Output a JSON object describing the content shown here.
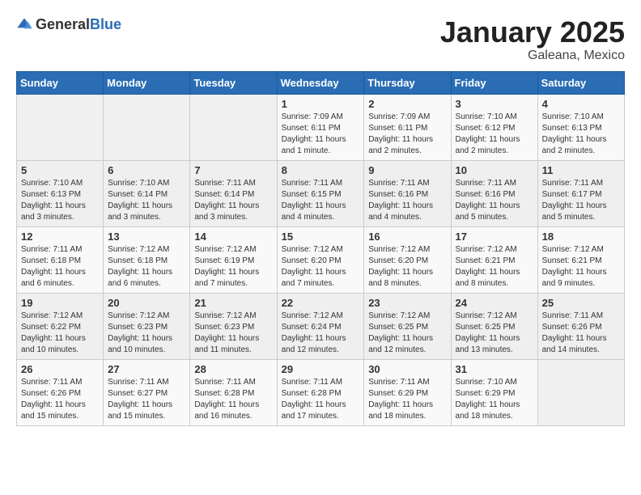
{
  "header": {
    "logo_general": "General",
    "logo_blue": "Blue",
    "month": "January 2025",
    "location": "Galeana, Mexico"
  },
  "weekdays": [
    "Sunday",
    "Monday",
    "Tuesday",
    "Wednesday",
    "Thursday",
    "Friday",
    "Saturday"
  ],
  "weeks": [
    [
      {
        "day": "",
        "info": ""
      },
      {
        "day": "",
        "info": ""
      },
      {
        "day": "",
        "info": ""
      },
      {
        "day": "1",
        "info": "Sunrise: 7:09 AM\nSunset: 6:11 PM\nDaylight: 11 hours and 1 minute."
      },
      {
        "day": "2",
        "info": "Sunrise: 7:09 AM\nSunset: 6:11 PM\nDaylight: 11 hours and 2 minutes."
      },
      {
        "day": "3",
        "info": "Sunrise: 7:10 AM\nSunset: 6:12 PM\nDaylight: 11 hours and 2 minutes."
      },
      {
        "day": "4",
        "info": "Sunrise: 7:10 AM\nSunset: 6:13 PM\nDaylight: 11 hours and 2 minutes."
      }
    ],
    [
      {
        "day": "5",
        "info": "Sunrise: 7:10 AM\nSunset: 6:13 PM\nDaylight: 11 hours and 3 minutes."
      },
      {
        "day": "6",
        "info": "Sunrise: 7:10 AM\nSunset: 6:14 PM\nDaylight: 11 hours and 3 minutes."
      },
      {
        "day": "7",
        "info": "Sunrise: 7:11 AM\nSunset: 6:14 PM\nDaylight: 11 hours and 3 minutes."
      },
      {
        "day": "8",
        "info": "Sunrise: 7:11 AM\nSunset: 6:15 PM\nDaylight: 11 hours and 4 minutes."
      },
      {
        "day": "9",
        "info": "Sunrise: 7:11 AM\nSunset: 6:16 PM\nDaylight: 11 hours and 4 minutes."
      },
      {
        "day": "10",
        "info": "Sunrise: 7:11 AM\nSunset: 6:16 PM\nDaylight: 11 hours and 5 minutes."
      },
      {
        "day": "11",
        "info": "Sunrise: 7:11 AM\nSunset: 6:17 PM\nDaylight: 11 hours and 5 minutes."
      }
    ],
    [
      {
        "day": "12",
        "info": "Sunrise: 7:11 AM\nSunset: 6:18 PM\nDaylight: 11 hours and 6 minutes."
      },
      {
        "day": "13",
        "info": "Sunrise: 7:12 AM\nSunset: 6:18 PM\nDaylight: 11 hours and 6 minutes."
      },
      {
        "day": "14",
        "info": "Sunrise: 7:12 AM\nSunset: 6:19 PM\nDaylight: 11 hours and 7 minutes."
      },
      {
        "day": "15",
        "info": "Sunrise: 7:12 AM\nSunset: 6:20 PM\nDaylight: 11 hours and 7 minutes."
      },
      {
        "day": "16",
        "info": "Sunrise: 7:12 AM\nSunset: 6:20 PM\nDaylight: 11 hours and 8 minutes."
      },
      {
        "day": "17",
        "info": "Sunrise: 7:12 AM\nSunset: 6:21 PM\nDaylight: 11 hours and 8 minutes."
      },
      {
        "day": "18",
        "info": "Sunrise: 7:12 AM\nSunset: 6:21 PM\nDaylight: 11 hours and 9 minutes."
      }
    ],
    [
      {
        "day": "19",
        "info": "Sunrise: 7:12 AM\nSunset: 6:22 PM\nDaylight: 11 hours and 10 minutes."
      },
      {
        "day": "20",
        "info": "Sunrise: 7:12 AM\nSunset: 6:23 PM\nDaylight: 11 hours and 10 minutes."
      },
      {
        "day": "21",
        "info": "Sunrise: 7:12 AM\nSunset: 6:23 PM\nDaylight: 11 hours and 11 minutes."
      },
      {
        "day": "22",
        "info": "Sunrise: 7:12 AM\nSunset: 6:24 PM\nDaylight: 11 hours and 12 minutes."
      },
      {
        "day": "23",
        "info": "Sunrise: 7:12 AM\nSunset: 6:25 PM\nDaylight: 11 hours and 12 minutes."
      },
      {
        "day": "24",
        "info": "Sunrise: 7:12 AM\nSunset: 6:25 PM\nDaylight: 11 hours and 13 minutes."
      },
      {
        "day": "25",
        "info": "Sunrise: 7:11 AM\nSunset: 6:26 PM\nDaylight: 11 hours and 14 minutes."
      }
    ],
    [
      {
        "day": "26",
        "info": "Sunrise: 7:11 AM\nSunset: 6:26 PM\nDaylight: 11 hours and 15 minutes."
      },
      {
        "day": "27",
        "info": "Sunrise: 7:11 AM\nSunset: 6:27 PM\nDaylight: 11 hours and 15 minutes."
      },
      {
        "day": "28",
        "info": "Sunrise: 7:11 AM\nSunset: 6:28 PM\nDaylight: 11 hours and 16 minutes."
      },
      {
        "day": "29",
        "info": "Sunrise: 7:11 AM\nSunset: 6:28 PM\nDaylight: 11 hours and 17 minutes."
      },
      {
        "day": "30",
        "info": "Sunrise: 7:11 AM\nSunset: 6:29 PM\nDaylight: 11 hours and 18 minutes."
      },
      {
        "day": "31",
        "info": "Sunrise: 7:10 AM\nSunset: 6:29 PM\nDaylight: 11 hours and 18 minutes."
      },
      {
        "day": "",
        "info": ""
      }
    ]
  ]
}
